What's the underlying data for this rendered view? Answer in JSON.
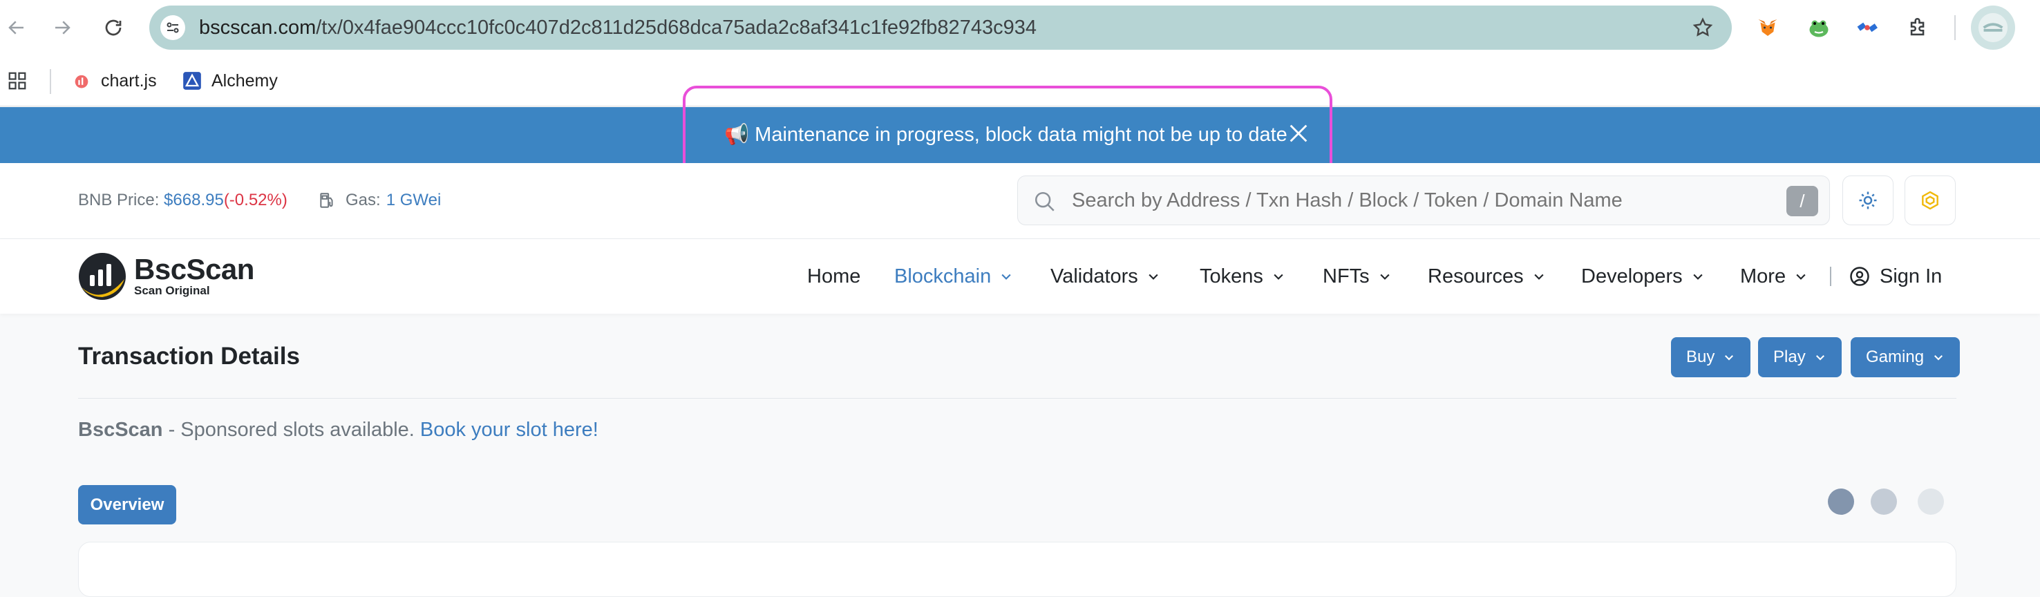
{
  "browser": {
    "url_host": "bscscan.com",
    "url_path": "/tx/0x4fae904ccc10fc0c407d2c811d25d68dca75ada2c8af341c1fe92fb82743c934",
    "bookmarks": [
      {
        "label": "chart.js",
        "icon": "chartjs-icon"
      },
      {
        "label": "Alchemy",
        "icon": "alchemy-icon"
      }
    ],
    "extensions": [
      "metamask-icon",
      "frog-extension-icon",
      "satellite-extension-icon",
      "puzzle-icon"
    ]
  },
  "banner": {
    "icon": "megaphone-icon",
    "text": "📢 Maintenance in progress, block data might not be up to date",
    "bg_color": "#3c85c3"
  },
  "topbar": {
    "price_label": "BNB Price:",
    "price_value": "$668.95",
    "price_change": "(-0.52%)",
    "gas_label": "Gas:",
    "gas_value": "1 GWei",
    "search_placeholder": "Search by Address / Txn Hash / Block / Token / Domain Name",
    "search_shortcut": "/"
  },
  "logo": {
    "name": "BscScan",
    "tagline": "Scan Original"
  },
  "nav": {
    "items": [
      {
        "label": "Home",
        "dropdown": false,
        "active": false
      },
      {
        "label": "Blockchain",
        "dropdown": true,
        "active": true
      },
      {
        "label": "Validators",
        "dropdown": true,
        "active": false
      },
      {
        "label": "Tokens",
        "dropdown": true,
        "active": false
      },
      {
        "label": "NFTs",
        "dropdown": true,
        "active": false
      },
      {
        "label": "Resources",
        "dropdown": true,
        "active": false
      },
      {
        "label": "Developers",
        "dropdown": true,
        "active": false
      },
      {
        "label": "More",
        "dropdown": true,
        "active": false
      }
    ],
    "sign_in": "Sign In"
  },
  "page": {
    "title": "Transaction Details",
    "buttons": [
      "Buy",
      "Play",
      "Gaming"
    ],
    "sponsor_brand": "BscScan",
    "sponsor_text": " - Sponsored slots available. ",
    "sponsor_link": "Book your slot here!",
    "tab_overview": "Overview"
  },
  "colors": {
    "accent": "#3d7dbf",
    "negative": "#dc3545",
    "highlight": "#e94fd9"
  }
}
